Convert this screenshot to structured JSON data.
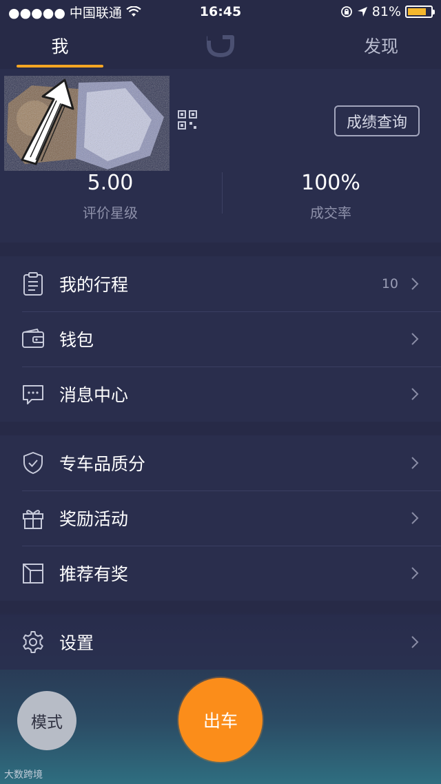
{
  "status_bar": {
    "carrier": "●●●●● 中国联通",
    "time": "16:45",
    "battery": "81%",
    "battery_level": 0.81
  },
  "tabs": {
    "me": "我",
    "find": "发现"
  },
  "profile": {
    "score_button": "成绩查询",
    "stats": [
      {
        "value": "5.00",
        "label": "评价星级"
      },
      {
        "value": "100%",
        "label": "成交率"
      }
    ]
  },
  "menu": {
    "trips": {
      "label": "我的行程",
      "count": "10"
    },
    "wallet": {
      "label": "钱包"
    },
    "messages": {
      "label": "消息中心"
    },
    "quality": {
      "label": "专车品质分"
    },
    "rewards": {
      "label": "奖励活动"
    },
    "referral": {
      "label": "推荐有奖"
    },
    "settings": {
      "label": "设置"
    }
  },
  "bottom": {
    "mode_button": "模式",
    "go_button": "出车"
  },
  "watermark": "大数跨境",
  "colors": {
    "accent": "#f5a623",
    "go_button": "#fb8d1a",
    "background": "#272a47"
  }
}
